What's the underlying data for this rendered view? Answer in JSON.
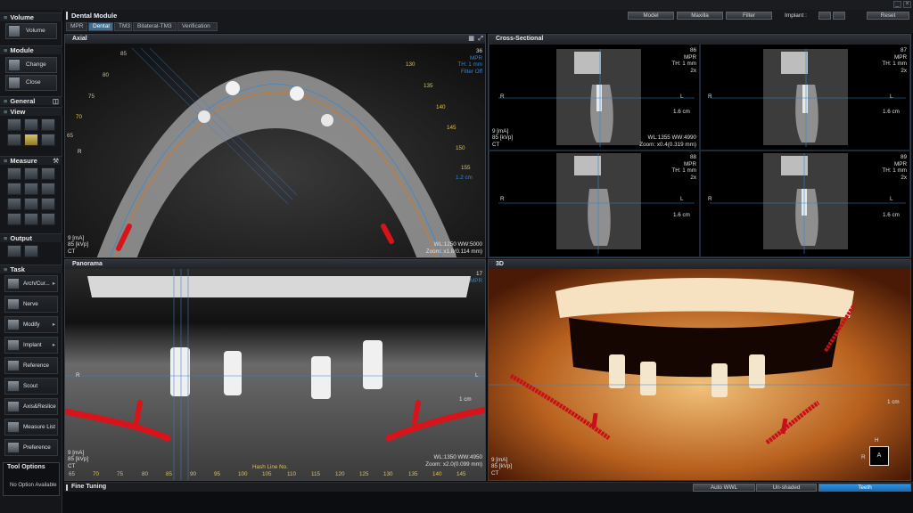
{
  "window": {
    "minimize_label": "_",
    "close_label": "×"
  },
  "sidebar": {
    "volume": {
      "title": "Volume",
      "btn": "Volume"
    },
    "module": {
      "title": "Module",
      "change": "Change",
      "close": "Close"
    },
    "general": {
      "title": "General",
      "view": "View"
    },
    "measure": {
      "title": "Measure"
    },
    "output": {
      "title": "Output"
    },
    "task": {
      "title": "Task",
      "items": [
        {
          "label": "Arch/Cur...",
          "arrow": "▸"
        },
        {
          "label": "Nerve",
          "arrow": ""
        },
        {
          "label": "Modify",
          "arrow": "▸"
        },
        {
          "label": "Implant",
          "arrow": "▸"
        },
        {
          "label": "Reference",
          "arrow": ""
        },
        {
          "label": "Scout",
          "arrow": ""
        },
        {
          "label": "Axis&Reslice",
          "arrow": ""
        },
        {
          "label": "Measure List",
          "arrow": ""
        },
        {
          "label": "Preference",
          "arrow": ""
        }
      ]
    },
    "tool_options": {
      "title": "Tool Options",
      "text": "No Option Available"
    }
  },
  "header": {
    "module_title": "Dental Module",
    "tabs": [
      "MPR",
      "Dental",
      "TM3",
      "Bilateral-TM3",
      "Verification"
    ],
    "buttons": {
      "model": "Model",
      "maxilla": "Maxilla",
      "filter": "Filter",
      "implant": "Implant :",
      "reset": "Reset"
    }
  },
  "axial": {
    "title": "Axial",
    "tr": [
      "36",
      "MPR",
      "TH: 1 mm",
      "Filter Off"
    ],
    "bl": [
      "9 [mA]",
      "85 [kVp]",
      "CT"
    ],
    "br": [
      "WL:1250 WW:5000",
      "Zoom: x1.8(0.114 mm)"
    ],
    "scale": "1.2 cm",
    "r_label": "R",
    "arch_numbers_left": [
      "85",
      "80",
      "75",
      "70",
      "65"
    ],
    "arch_numbers_right": [
      "130",
      "135",
      "140",
      "145",
      "150",
      "155"
    ]
  },
  "cross": {
    "title": "Cross-Sectional",
    "cells": [
      {
        "id": "86",
        "tags": [
          "MPR",
          "TH: 1 mm",
          "2x"
        ],
        "scale": "1.6 cm"
      },
      {
        "id": "87",
        "tags": [
          "MPR",
          "TH: 1 mm",
          "2x"
        ],
        "scale": "1.6 cm"
      },
      {
        "id": "88",
        "tags": [
          "MPR",
          "TH: 1 mm",
          "2x"
        ],
        "scale": "1.6 cm"
      },
      {
        "id": "89",
        "tags": [
          "MPR",
          "TH: 1 mm",
          "2x"
        ],
        "scale": "1.6 cm"
      }
    ],
    "r_label": "R",
    "l_label": "L",
    "bl": [
      "9 [mA]",
      "85 [kVp]",
      "CT"
    ],
    "br": [
      "WL:1355 WW:4990",
      "Zoom: x0.4(0.319 mm)"
    ]
  },
  "panorama": {
    "title": "Panorama",
    "tr": [
      "17",
      "MPR"
    ],
    "bl": [
      "9 [mA]",
      "85 [kVp]",
      "CT"
    ],
    "br": [
      "WL:1350 WW:4950",
      "Zoom: x2.0(0.099 mm)"
    ],
    "caption": "Hash Line No.",
    "scale": "1 cm",
    "r_label": "R",
    "l_label": "L",
    "ruler": [
      "65",
      "70",
      "75",
      "80",
      "85",
      "90",
      "95",
      "100",
      "105",
      "110",
      "115",
      "120",
      "125",
      "130",
      "135",
      "140",
      "145"
    ]
  },
  "three_d": {
    "title": "3D",
    "bl": [
      "9 [mA]",
      "85 [kVp]",
      "CT"
    ],
    "scale": "1 cm",
    "cube": {
      "h": "H",
      "r": "R",
      "a": "A"
    }
  },
  "bottom": {
    "title": "Fine Tuning",
    "auto_wwl": "Auto WWL",
    "unshaded": "Un-shaded",
    "teeth": "Teeth"
  },
  "colors": {
    "accent_blue": "#2d87d8",
    "nerve_red": "#d8141a",
    "annot_yellow": "#e0c050",
    "teeth_active": "#1f7fcf"
  }
}
